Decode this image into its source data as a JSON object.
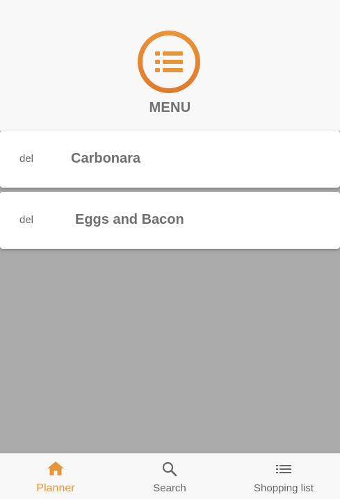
{
  "header": {
    "title": "MENU",
    "logo_icon": "list-icon",
    "accent_color": "#e8943a"
  },
  "recipes": [
    {
      "delete_label": "del",
      "name": "Carbonara"
    },
    {
      "delete_label": "del",
      "name": "Eggs and Bacon"
    }
  ],
  "bottom_nav": {
    "items": [
      {
        "label": "Planner",
        "icon": "home-icon",
        "active": true
      },
      {
        "label": "Search",
        "icon": "search-icon",
        "active": false
      },
      {
        "label": "Shopping list",
        "icon": "list-icon",
        "active": false
      }
    ]
  }
}
